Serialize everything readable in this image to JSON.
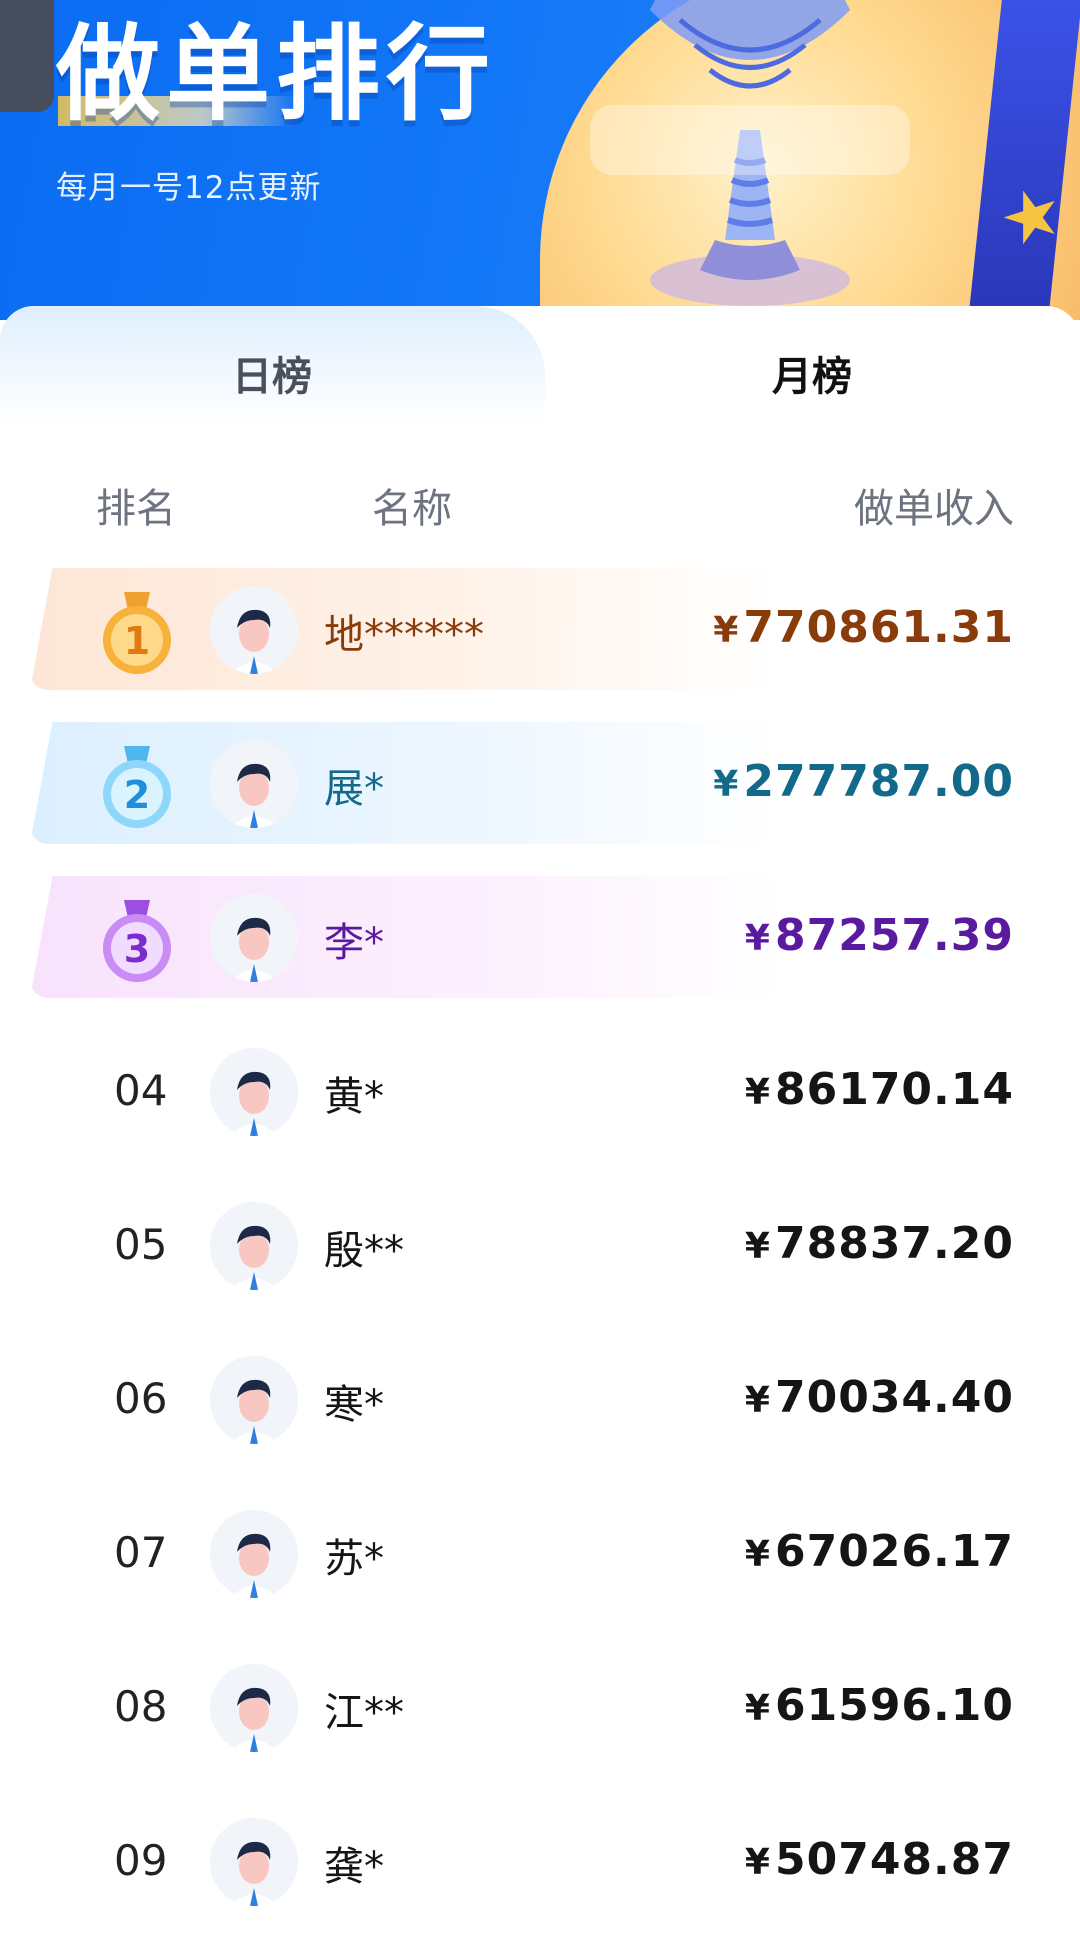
{
  "header": {
    "title": "做单排行",
    "subtitle": "每月一号12点更新"
  },
  "tabs": [
    {
      "label": "日榜",
      "active": false
    },
    {
      "label": "月榜",
      "active": true
    }
  ],
  "columns": {
    "rank": "排名",
    "name": "名称",
    "income": "做单收入"
  },
  "currency_symbol": "¥",
  "rows": [
    {
      "rank": "1",
      "name": "地******",
      "amount": "770861.31"
    },
    {
      "rank": "2",
      "name": "展*",
      "amount": "277787.00"
    },
    {
      "rank": "3",
      "name": "李*",
      "amount": "87257.39"
    },
    {
      "rank": "04",
      "name": "黄*",
      "amount": "86170.14"
    },
    {
      "rank": "05",
      "name": "殷**",
      "amount": "78837.20"
    },
    {
      "rank": "06",
      "name": "寒*",
      "amount": "70034.40"
    },
    {
      "rank": "07",
      "name": "苏*",
      "amount": "67026.17"
    },
    {
      "rank": "08",
      "name": "江**",
      "amount": "61596.10"
    },
    {
      "rank": "09",
      "name": "龚*",
      "amount": "50748.87"
    }
  ],
  "colors": {
    "banner_blue": "#0b6cf2",
    "gold": "#8a3b0a",
    "silver": "#126a8a",
    "bronze": "#5a1aa0"
  }
}
